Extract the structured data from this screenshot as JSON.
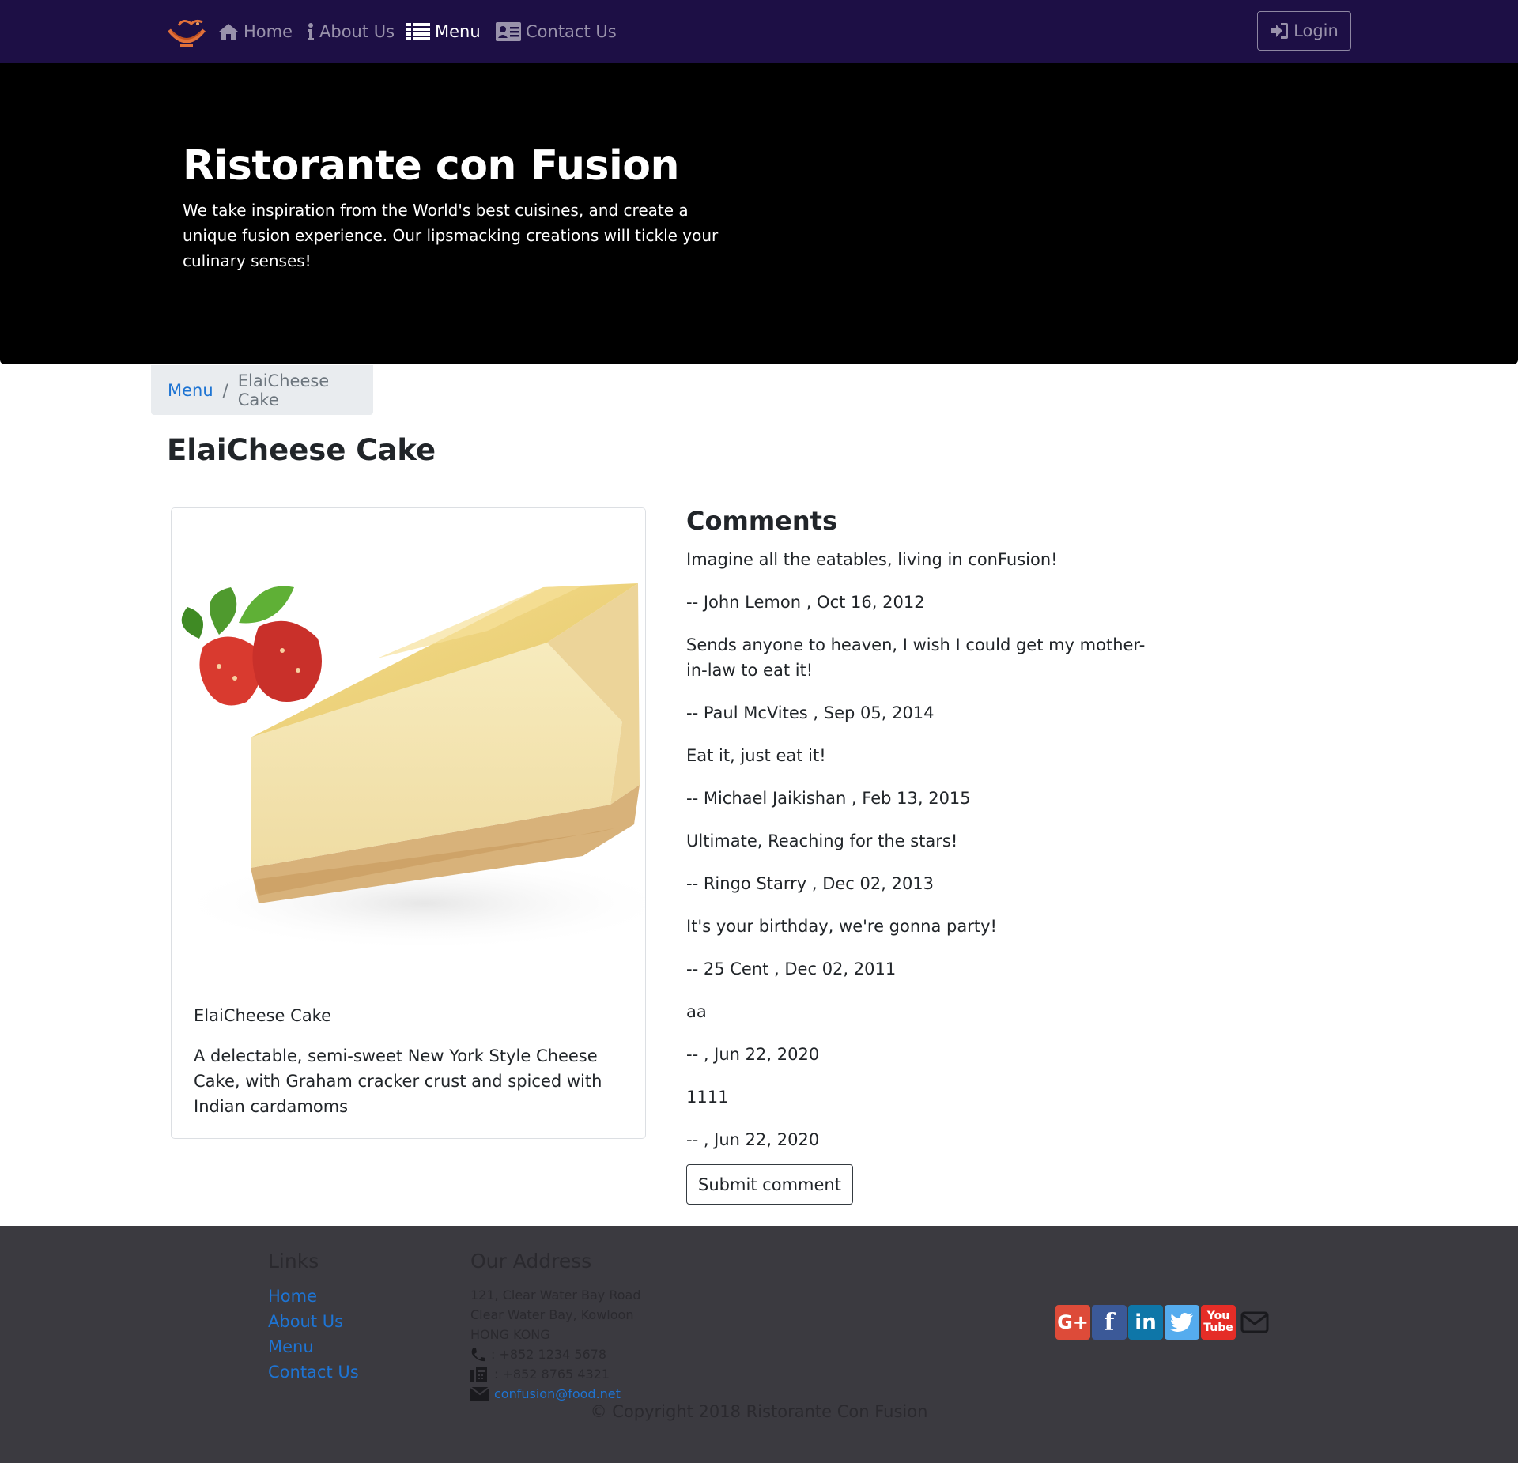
{
  "nav": {
    "items": [
      {
        "label": "Home",
        "icon": "home-icon"
      },
      {
        "label": "About Us",
        "icon": "info-icon"
      },
      {
        "label": "Menu",
        "icon": "list-icon",
        "active": true
      },
      {
        "label": "Contact Us",
        "icon": "address-card-icon"
      }
    ],
    "login_label": "Login",
    "background": "#1d0f45"
  },
  "jumbotron": {
    "title": "Ristorante con Fusion",
    "text": "We take inspiration from the World's best cuisines, and create a unique fusion experience. Our lipsmacking creations will tickle your culinary senses!"
  },
  "breadcrumb": {
    "link": "Menu",
    "separator": "/",
    "current": "ElaiCheese Cake"
  },
  "page": {
    "title": "ElaiCheese Cake"
  },
  "dish": {
    "name": "ElaiCheese Cake",
    "description": "A delectable, semi-sweet New York Style Cheese Cake, with Graham cracker crust and spiced with Indian cardamoms"
  },
  "comments": {
    "title": "Comments",
    "items": [
      {
        "text": "Imagine all the eatables, living in conFusion!",
        "meta": "-- John Lemon , Oct 16, 2012"
      },
      {
        "text": "Sends anyone to heaven, I wish I could get my mother-in-law to eat it!",
        "meta": "-- Paul McVites , Sep 05, 2014"
      },
      {
        "text": "Eat it, just eat it!",
        "meta": "-- Michael Jaikishan , Feb 13, 2015"
      },
      {
        "text": "Ultimate, Reaching for the stars!",
        "meta": "-- Ringo Starry , Dec 02, 2013"
      },
      {
        "text": "It's your birthday, we're gonna party!",
        "meta": "-- 25 Cent , Dec 02, 2011"
      },
      {
        "text": "aa",
        "meta": "-- , Jun 22, 2020"
      },
      {
        "text": "1111",
        "meta": "-- , Jun 22, 2020"
      }
    ],
    "submit_label": "Submit comment"
  },
  "footer": {
    "links_title": "Links",
    "links": [
      "Home",
      "About Us",
      "Menu",
      "Contact Us"
    ],
    "address_title": "Our Address",
    "address_lines": [
      "121, Clear Water Bay Road",
      "Clear Water Bay, Kowloon",
      "HONG KONG"
    ],
    "phone": ": +852 1234 5678",
    "fax": ": +852 8765 4321",
    "email": "confusion@food.net",
    "social": [
      "google-plus-icon",
      "facebook-icon",
      "linkedin-icon",
      "twitter-icon",
      "youtube-icon",
      "envelope-icon"
    ],
    "copyright": "© Copyright 2018 Ristorante Con Fusion"
  }
}
